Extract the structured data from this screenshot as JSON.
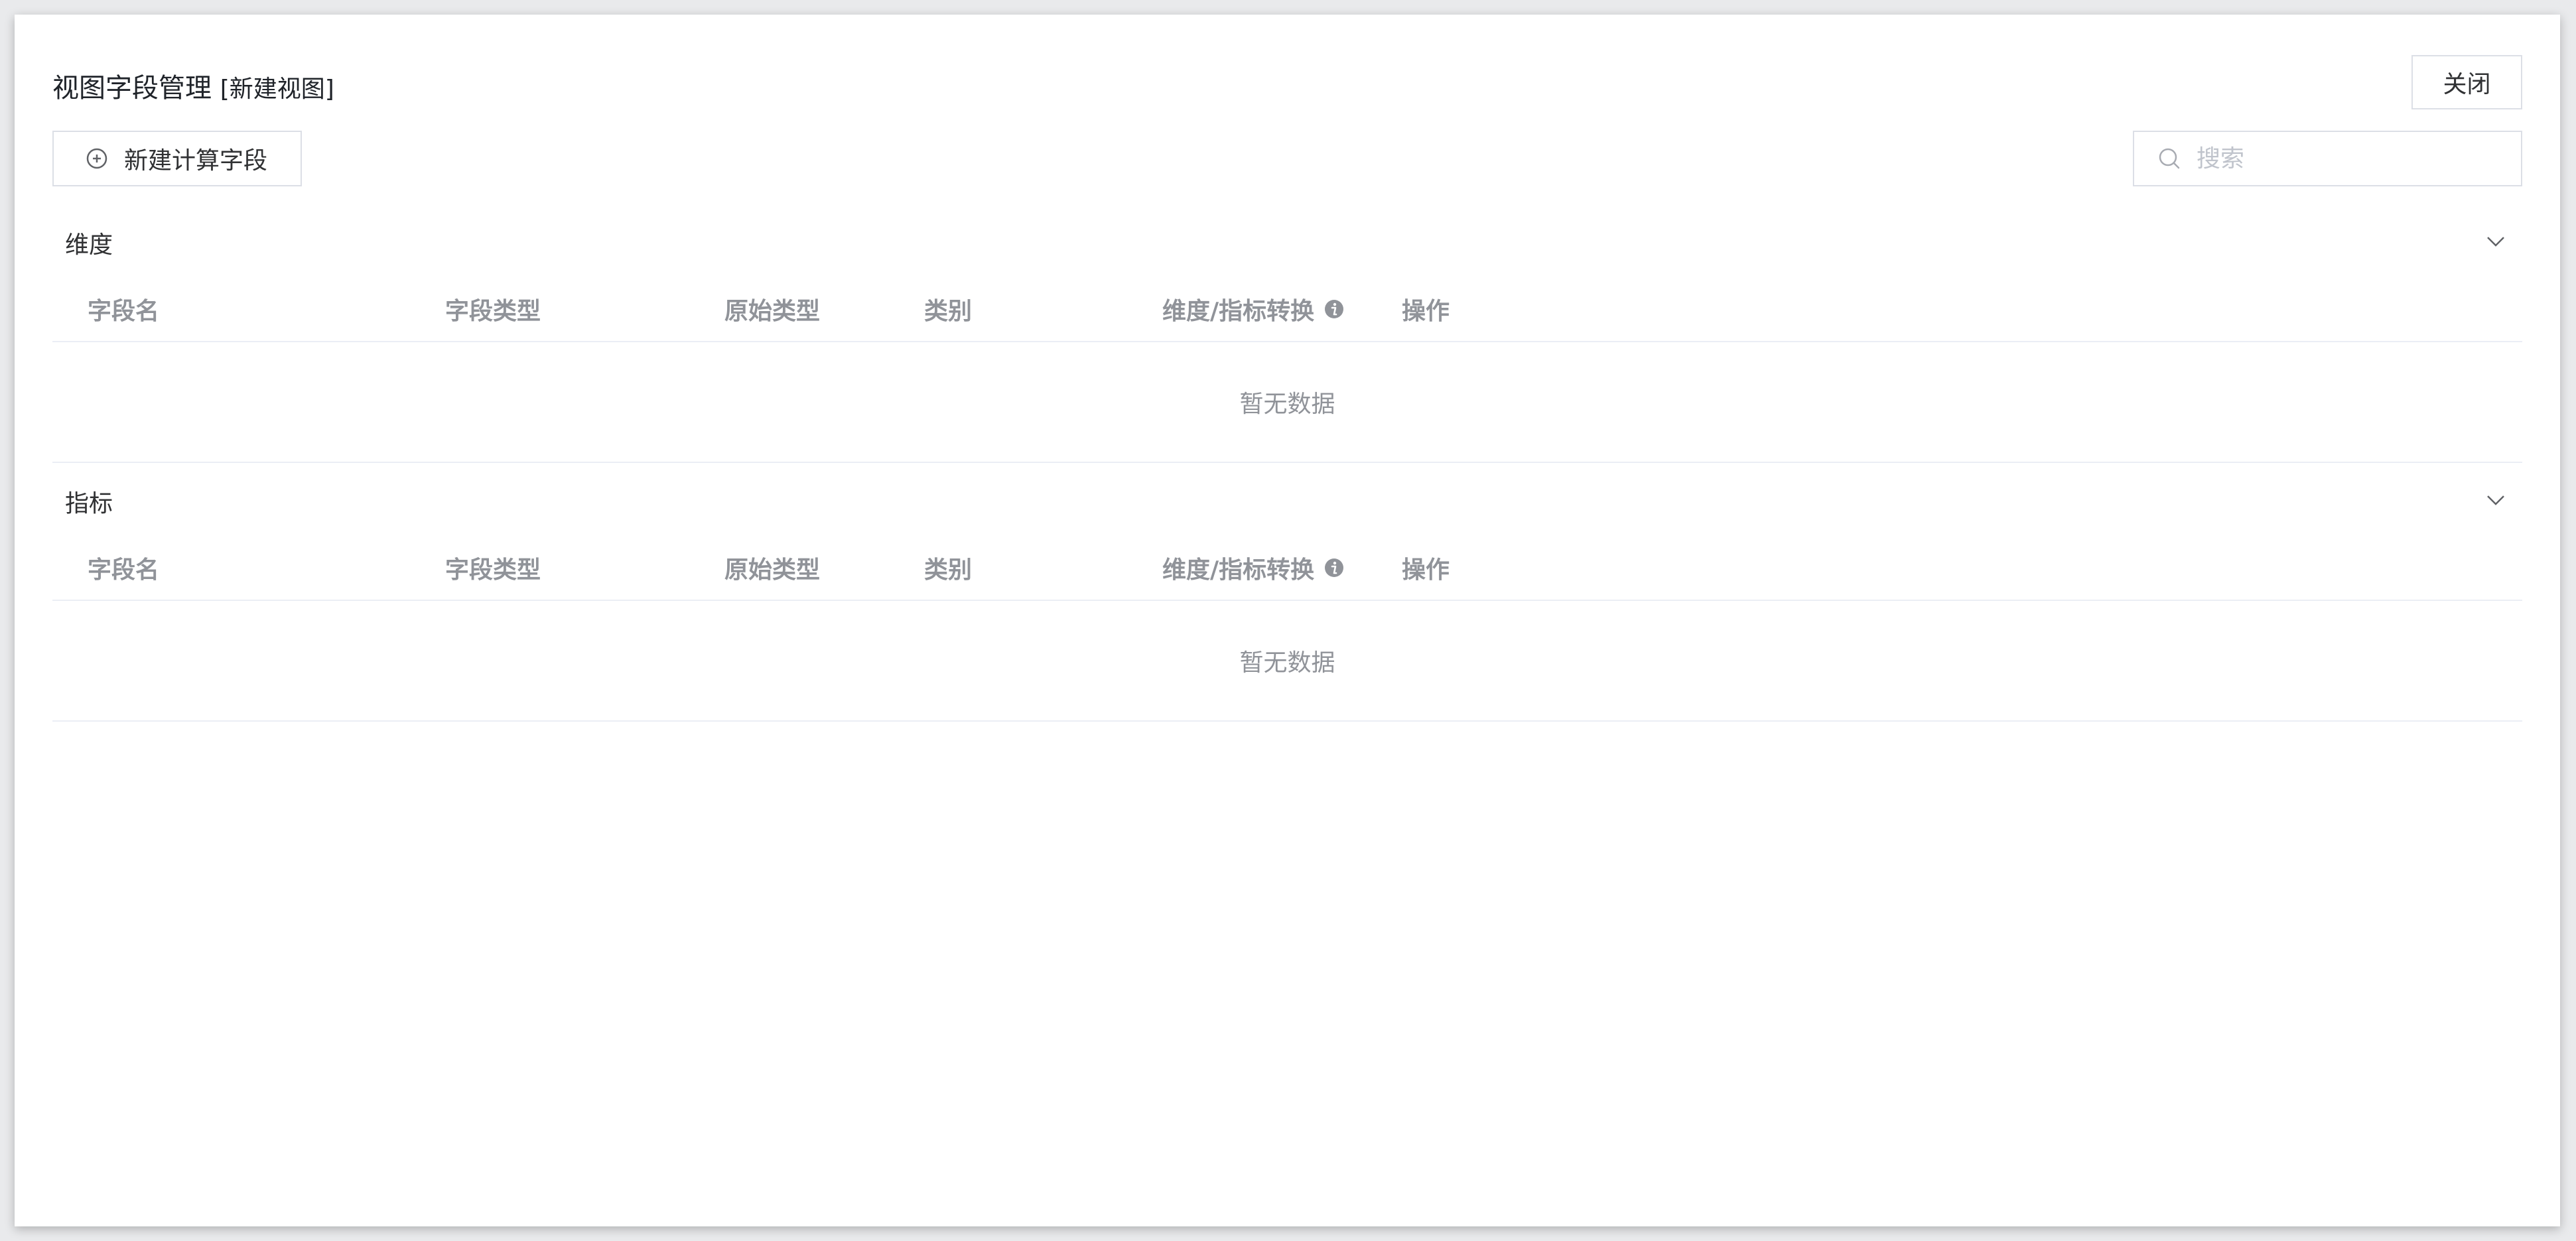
{
  "dialog": {
    "title": "视图字段管理",
    "subtitle": "[新建视图]",
    "close_label": "关闭"
  },
  "toolbar": {
    "new_calc_field_label": "新建计算字段",
    "search_placeholder": "搜索"
  },
  "columns": [
    "字段名",
    "字段类型",
    "原始类型",
    "类别",
    "维度/指标转换",
    "操作"
  ],
  "sections": [
    {
      "title": "维度",
      "empty_text": "暂无数据"
    },
    {
      "title": "指标",
      "empty_text": "暂无数据"
    }
  ],
  "icons": {
    "add": "plus-circle-icon",
    "search": "search-icon",
    "collapse": "chevron-down-icon",
    "info": "info-icon"
  }
}
